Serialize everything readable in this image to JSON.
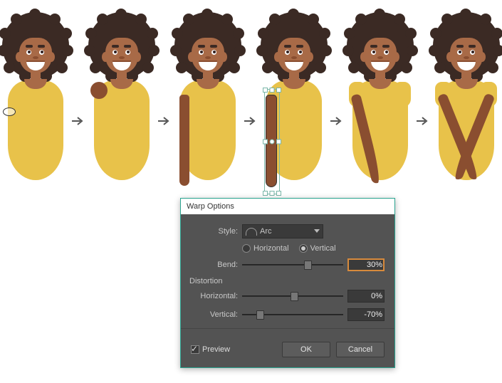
{
  "dialog": {
    "title": "Warp Options",
    "style_label": "Style:",
    "style_value": "Arc",
    "orientation": {
      "horizontal": "Horizontal",
      "vertical": "Vertical",
      "selected": "vertical"
    },
    "bend": {
      "label": "Bend:",
      "value": "30%"
    },
    "distortion_title": "Distortion",
    "dist_h": {
      "label": "Horizontal:",
      "value": "0%"
    },
    "dist_v": {
      "label": "Vertical:",
      "value": "-70%"
    },
    "preview": {
      "label": "Preview",
      "checked": true
    },
    "ok": "OK",
    "cancel": "Cancel"
  },
  "strip": {
    "step_count": 6
  }
}
